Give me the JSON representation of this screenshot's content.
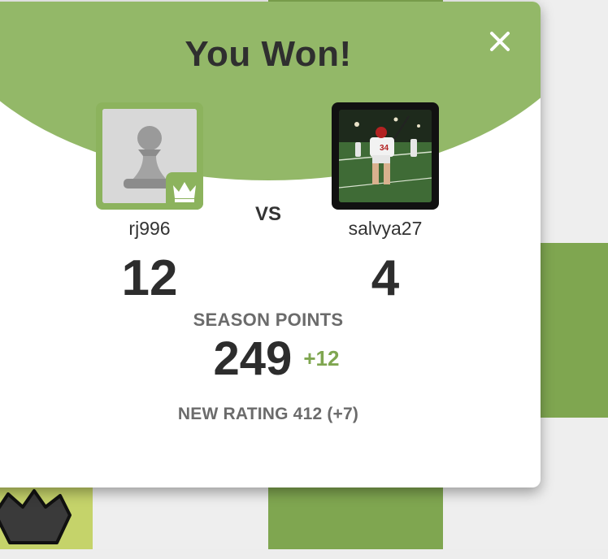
{
  "modal": {
    "title": "You Won!",
    "vs_label": "VS"
  },
  "players": {
    "left": {
      "username": "rj996",
      "score": "12",
      "avatar": "pawn-avatar",
      "badge": "crown-icon"
    },
    "right": {
      "username": "salvya27",
      "score": "4",
      "avatar": "lacrosse-player-photo"
    }
  },
  "season_points": {
    "label": "SEASON POINTS",
    "value": "249",
    "delta": "+12"
  },
  "rating": {
    "text": "NEW RATING 412 (+7)"
  },
  "colors": {
    "header_green": "#93b868",
    "accent_green": "#7fa650",
    "board_dark": "#7fa650",
    "board_light": "#eeeeee"
  }
}
